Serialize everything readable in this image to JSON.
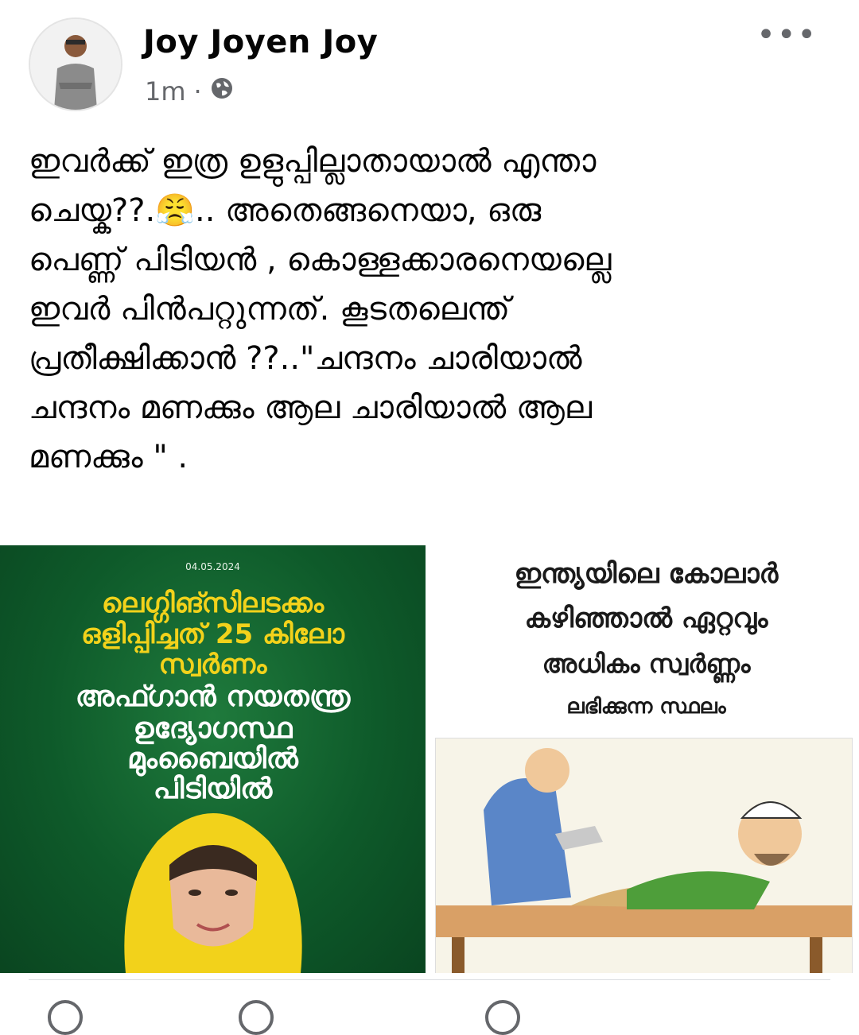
{
  "post": {
    "author": "Joy Joyen Joy",
    "time": "1m",
    "separator": "·",
    "privacy_icon": "globe-icon",
    "more_icon": "more-options-icon",
    "more_glyph": "•••",
    "text_lines": [
      "ഇവർക്ക് ഇത്ര ഉളുപ്പില്ലാതായാൽ എന്താ",
      "ചെയ്ക??.😤.. അതെങ്ങനെയാ, ഒരു",
      "പെണ്ണ് പിടിയൻ , കൊള്ളക്കാരനെയല്ലെ",
      "ഇവർ പിൻപറ്റുന്നത്. കൂടതലെന്ത്",
      "പ്രതീക്ഷിക്കാൻ ??..\"ചന്ദനം ചാരിയാൽ",
      "ചന്ദനം മണക്കും ആല ചാരിയാൽ ആല",
      "മണക്കും \" ."
    ]
  },
  "left_image": {
    "date": "04.05.2024",
    "lines_yellow": [
      "ലെഗ്ഗിങ്സിലടക്കം",
      "ഒളിപ്പിച്ചത് 25 കിലോ",
      "സ്വർണം"
    ],
    "lines_white": [
      "അഫ്ഗാൻ നയതന്ത്ര",
      "ഉദ്യോഗസ്ഥ",
      "മുംബൈയിൽ",
      "പിടിയിൽ"
    ],
    "bg_color": "#0e5a2a",
    "accent_color": "#f2d21b"
  },
  "right_image": {
    "lines": [
      "ഇന്ത്യയിലെ കോലാർ",
      "കഴിഞ്ഞാൽ ഏറ്റവും",
      "അധികം സ്വർണ്ണം",
      "ലഭിക്കുന്ന സ്ഥലം"
    ]
  },
  "colors": {
    "text": "#050505",
    "meta": "#65676b"
  }
}
